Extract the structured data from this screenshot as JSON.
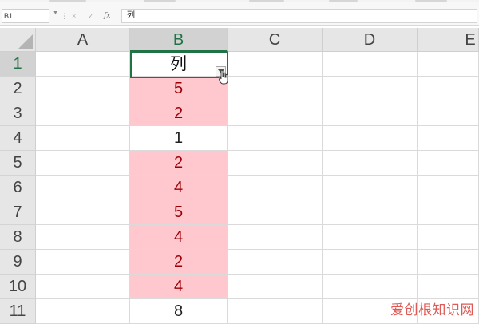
{
  "formula_bar": {
    "name_box": "B1",
    "cancel_symbol": "×",
    "enter_symbol": "✓",
    "function_symbol": "fx",
    "formula_content": "列"
  },
  "columns": [
    "A",
    "B",
    "C",
    "D",
    "E"
  ],
  "rows": [
    "1",
    "2",
    "3",
    "4",
    "5",
    "6",
    "7",
    "8",
    "9",
    "10",
    "11"
  ],
  "column_b_values": [
    "列",
    "5",
    "2",
    "1",
    "2",
    "4",
    "5",
    "4",
    "2",
    "4",
    "8"
  ],
  "highlight": {
    "fill_color": "#ffc7ce",
    "text_color": "#9c0006",
    "highlighted_rows": [
      2,
      3,
      5,
      6,
      7,
      8,
      9,
      10
    ]
  },
  "active_cell": "B1",
  "watermark": "爱创根知识网"
}
